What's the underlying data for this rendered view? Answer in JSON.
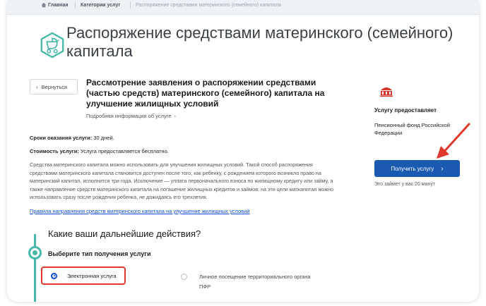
{
  "breadcrumbs": {
    "home": "Главная",
    "categories": "Категории услуг",
    "current": "Распоряжение средствами материнского (семейного) капитала"
  },
  "page": {
    "title": "Распоряжение средствами материнского (семейного) капитала",
    "back_label": "Вернуться"
  },
  "service": {
    "title": "Рассмотрение заявления о распоряжении средствами (частью средств) материнского (семейного) капитала на улучшение жилищных условий",
    "more_info": "Подробная информация об услуге",
    "term_label": "Сроки оказания услуги:",
    "term_value": "30 дней.",
    "cost_label": "Стоимость услуги:",
    "cost_value": "Услуга предоставляется бесплатно.",
    "description": "Средства материнского капитала можно использовать для улучшения жилищных условий. Такой способ распоряжения средствами материнского капитала становится доступен после того, как ребенку, с рождением которого возникло право на материнский капитал, исполнится три года. Исключение — уплата первоначального взноса по жилищному кредиту или займу, а также направление средств материнского капитала на погашение жилищных кредитов и займов: на эти цели маткапитал можно использовать сразу после рождения ребенка, не дожидаясь его трехлетия.",
    "rules_link": "Правила направления средств материнского капитала на улучшение жилищных условий"
  },
  "actions": {
    "heading": "Какие ваши дальнейшие действия?",
    "step_title": "Выберите тип получения услуги",
    "option_electronic": "Электронная услуга",
    "option_visit": "Личное посещение территориального органа ПФР"
  },
  "provider": {
    "label": "Услугу предоставляет",
    "name": "Пенсионный фонд Российской Федерации",
    "button": "Получить услугу",
    "time_note": "Это займет у вас 20 минут"
  },
  "colors": {
    "accent_teal": "#47b8a8",
    "button_blue": "#1a5ab0",
    "link_blue": "#0d4cd3",
    "highlight_red": "#e0382d"
  }
}
